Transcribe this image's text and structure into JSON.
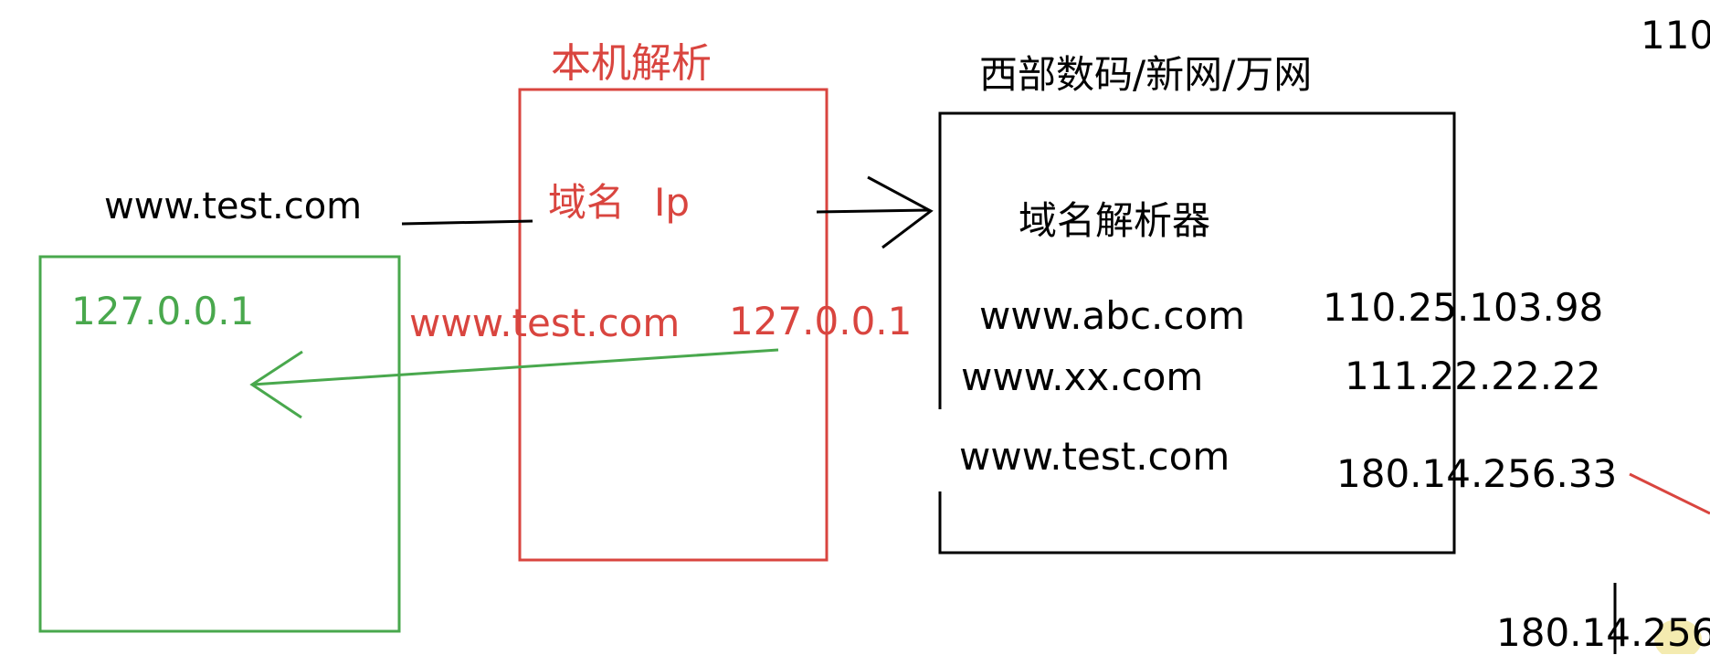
{
  "colors": {
    "ink": "#000000",
    "red": "#d9453f",
    "green": "#49a84d",
    "highlight": "#f3e9a7"
  },
  "client": {
    "request_domain": "www.test.com",
    "result_ip": "127.0.0.1"
  },
  "hosts": {
    "title": "本机解析",
    "header_domain": "域名",
    "header_ip": "Ip",
    "entry_domain": "www.test.com",
    "entry_ip": "127.0.0.1"
  },
  "registrar": {
    "title": "西部数码/新网/万网",
    "resolver_label": "域名解析器",
    "records": [
      {
        "domain": "www.abc.com",
        "ip": "110.25.103.98"
      },
      {
        "domain": "www.xx.com",
        "ip": "111.22.22.22"
      },
      {
        "domain": "www.test.com",
        "ip": "180.14.256.33"
      }
    ]
  },
  "edge_texts": {
    "top_right": "110",
    "bottom_right": "180.14.256"
  }
}
